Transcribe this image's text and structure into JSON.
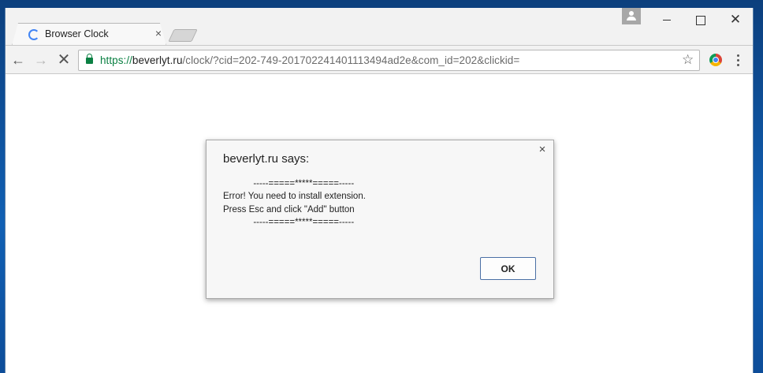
{
  "tab": {
    "title": "Browser Clock",
    "close_glyph": "×"
  },
  "window_controls": {
    "close_glyph": "✕"
  },
  "nav": {
    "back_glyph": "←",
    "forward_glyph": "→",
    "stop_glyph": "✕"
  },
  "address": {
    "scheme": "https://",
    "host": "beverlyt.ru",
    "path": "/clock/?cid=202-749-201702241401113494ad2e&com_id=202&clickid="
  },
  "bookmark_glyph": "☆",
  "dialog": {
    "title": "beverlyt.ru says:",
    "message": "            -----=====*****=====-----\nError! You need to install extension.\nPress Esc and click \"Add\" button\n            -----=====*****=====-----",
    "close_glyph": "×",
    "ok_label": "OK"
  }
}
